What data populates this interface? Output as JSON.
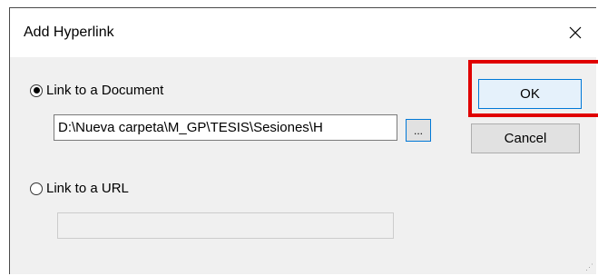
{
  "dialog": {
    "title": "Add Hyperlink",
    "close_symbol": "✕",
    "doc_option_label": "Link to a Document",
    "doc_option_checked": true,
    "doc_path": "D:\\Nueva carpeta\\M_GP\\TESIS\\Sesiones\\H",
    "browse_label": "...",
    "url_option_label": "Link to a URL",
    "url_option_checked": false,
    "url_value": "",
    "ok_label": "OK",
    "cancel_label": "Cancel"
  },
  "colors": {
    "highlight": "#e00000",
    "focus_blue": "#0078d7"
  }
}
